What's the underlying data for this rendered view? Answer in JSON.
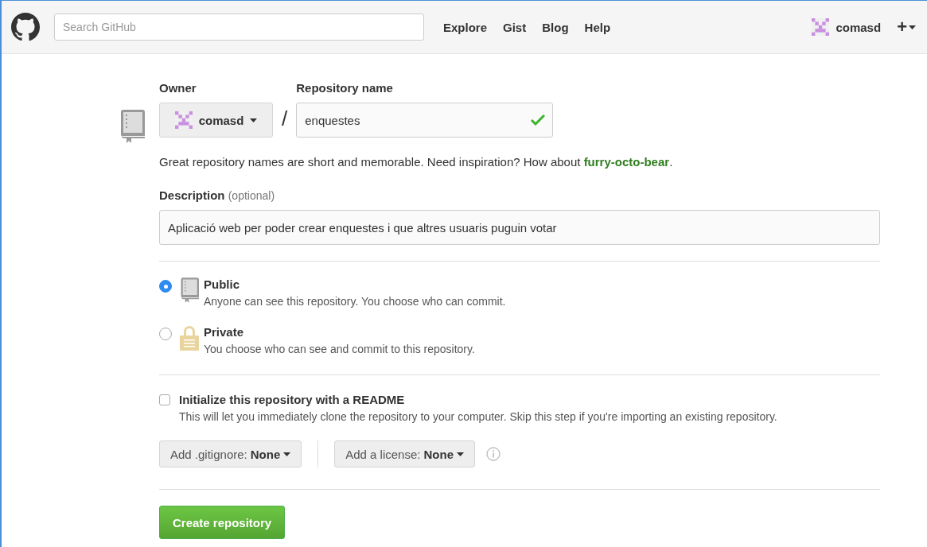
{
  "header": {
    "search": {
      "placeholder": "Search GitHub"
    },
    "nav": [
      "Explore",
      "Gist",
      "Blog",
      "Help"
    ],
    "user": "comasd",
    "new_menu": "+"
  },
  "form": {
    "owner_label": "Owner",
    "owner": "comasd",
    "separator": "/",
    "name_label": "Repository name",
    "name_value": "enquestes",
    "name_valid": true,
    "hint": "Great repository names are short and memorable. Need inspiration? How about",
    "suggestion": "furry-octo-bear",
    "hint_end": ".",
    "description_label": "Description",
    "description_note": "(optional)",
    "description_value": "Aplicació web per poder crear enquestes i que altres usuaris puguin votar",
    "visibility": [
      {
        "kind": "public",
        "label": "Public",
        "text": "Anyone can see this repository. You choose who can commit.",
        "selected": true
      },
      {
        "kind": "private",
        "label": "Private",
        "text": "You choose who can see and commit to this repository.",
        "selected": false
      }
    ],
    "readme": {
      "label": "Initialize this repository with a README",
      "text": "This will let you immediately clone the repository to your computer. Skip this step if you're importing an existing repository.",
      "checked": false
    },
    "gitignore": {
      "label": "Add .gitignore:",
      "value": "None"
    },
    "license": {
      "label": "Add a license:",
      "value": "None"
    },
    "submit": "Create repository"
  }
}
